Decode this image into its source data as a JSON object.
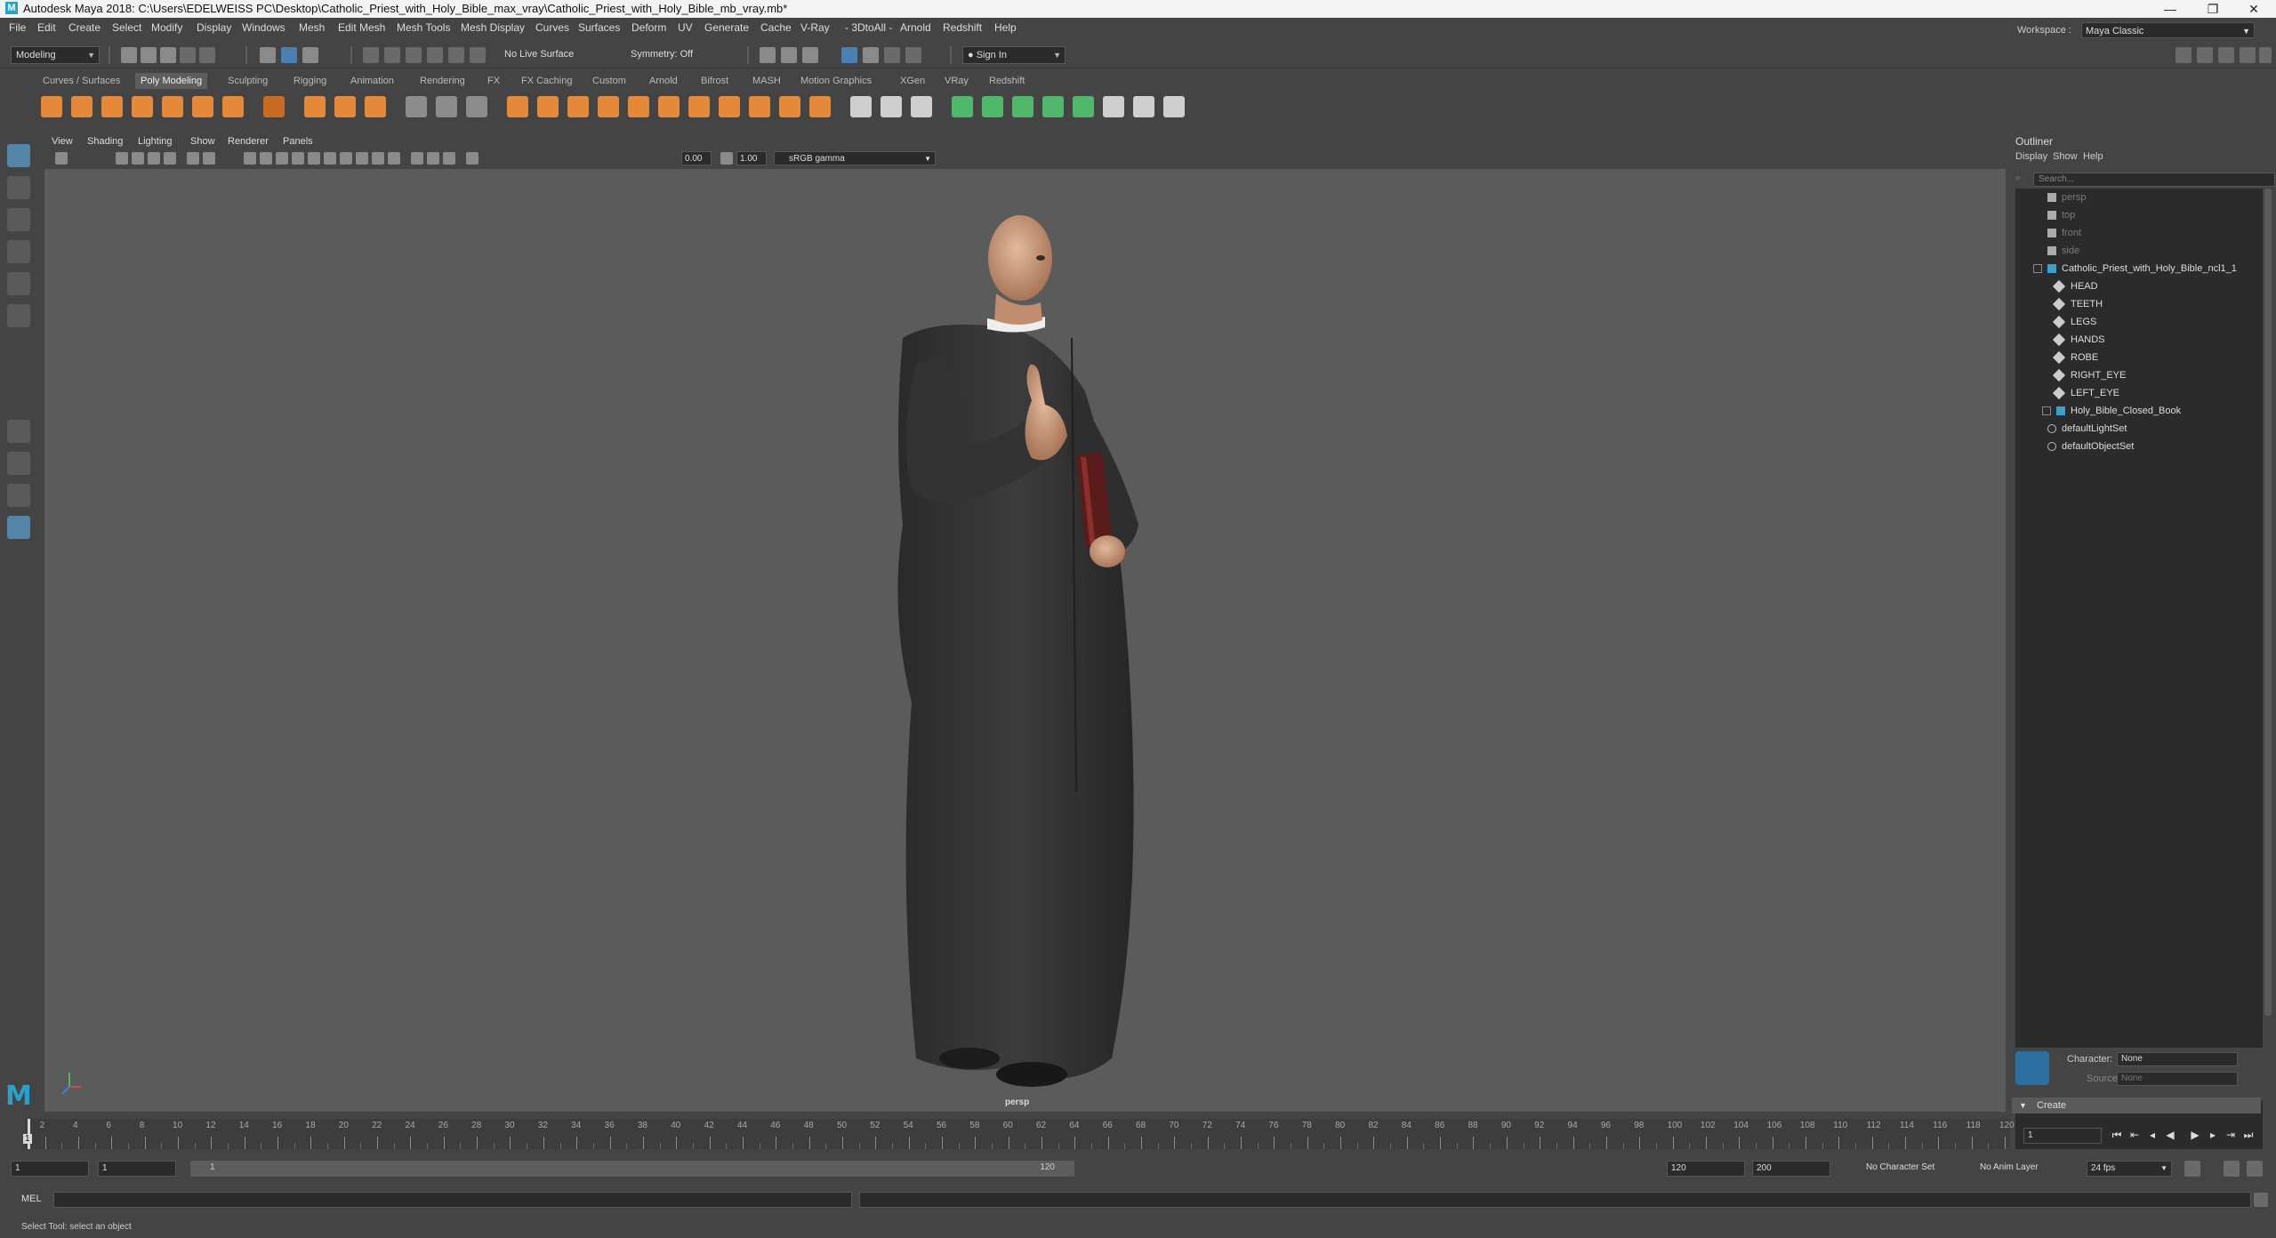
{
  "titlebar": {
    "title": "Autodesk Maya 2018: C:\\Users\\EDELWEISS PC\\Desktop\\Catholic_Priest_with_Holy_Bible_max_vray\\Catholic_Priest_with_Holy_Bible_mb_vray.mb*",
    "logo": "M",
    "minimize": "—",
    "maximize": "❐",
    "close": "✕"
  },
  "menubar": {
    "items": [
      "File",
      "Edit",
      "Create",
      "Select",
      "Modify",
      "Display",
      "Windows",
      "Mesh",
      "Edit Mesh",
      "Mesh Tools",
      "Mesh Display",
      "Curves",
      "Surfaces",
      "Deform",
      "UV",
      "Generate",
      "Cache",
      "V-Ray",
      "- 3DtoAll -",
      "Arnold",
      "Redshift",
      "Help"
    ],
    "workspace_label": "Workspace :",
    "workspace_value": "Maya Classic"
  },
  "statusline": {
    "mode": "Modeling",
    "live_surface": "No Live Surface",
    "symmetry": "Symmetry: Off",
    "sign_in": "Sign In"
  },
  "shelf": {
    "tabs": [
      "Curves / Surfaces",
      "Poly Modeling",
      "Sculpting",
      "Rigging",
      "Animation",
      "Rendering",
      "FX",
      "FX Caching",
      "Custom",
      "Arnold",
      "Bifrost",
      "MASH",
      "Motion Graphics",
      "XGen",
      "VRay",
      "Redshift"
    ],
    "active_tab": "Poly Modeling"
  },
  "viewport": {
    "menus": [
      "View",
      "Shading",
      "Lighting",
      "Show",
      "Renderer",
      "Panels"
    ],
    "exposure": "0.00",
    "gamma": "1.00",
    "color_space": "sRGB gamma",
    "camera_label": "persp"
  },
  "outliner": {
    "title": "Outliner",
    "menus": [
      "Display",
      "Show",
      "Help"
    ],
    "search_placeholder": "Search...",
    "items": [
      {
        "label": "persp",
        "kind": "camera",
        "indent": 0
      },
      {
        "label": "top",
        "kind": "camera",
        "indent": 0
      },
      {
        "label": "front",
        "kind": "camera",
        "indent": 0
      },
      {
        "label": "side",
        "kind": "camera",
        "indent": 0
      },
      {
        "label": "Catholic_Priest_with_Holy_Bible_ncl1_1",
        "kind": "group",
        "indent": 0
      },
      {
        "label": "HEAD",
        "kind": "mesh",
        "indent": 1
      },
      {
        "label": "TEETH",
        "kind": "mesh",
        "indent": 1
      },
      {
        "label": "LEGS",
        "kind": "mesh",
        "indent": 1
      },
      {
        "label": "HANDS",
        "kind": "mesh",
        "indent": 1
      },
      {
        "label": "ROBE",
        "kind": "mesh",
        "indent": 1
      },
      {
        "label": "RIGHT_EYE",
        "kind": "mesh",
        "indent": 1
      },
      {
        "label": "LEFT_EYE",
        "kind": "mesh",
        "indent": 1
      },
      {
        "label": "Holy_Bible_Closed_Book",
        "kind": "group",
        "indent": 1
      },
      {
        "label": "defaultLightSet",
        "kind": "set",
        "indent": 0
      },
      {
        "label": "defaultObjectSet",
        "kind": "set",
        "indent": 0
      }
    ]
  },
  "character": {
    "character_label": "Character:",
    "character_value": "None",
    "source_label": "Source:",
    "source_value": "None",
    "create_label": "Create"
  },
  "timeline": {
    "ticks": [
      2,
      4,
      6,
      8,
      10,
      12,
      14,
      16,
      18,
      20,
      22,
      24,
      26,
      28,
      30,
      32,
      34,
      36,
      38,
      40,
      42,
      44,
      46,
      48,
      50,
      52,
      54,
      56,
      58,
      60,
      62,
      64,
      66,
      68,
      70,
      72,
      74,
      76,
      78,
      80,
      82,
      84,
      86,
      88,
      90,
      92,
      94,
      96,
      98,
      100,
      102,
      104,
      106,
      108,
      110,
      112,
      114,
      116,
      118,
      120
    ],
    "start_tick": "1",
    "current_frame": "1",
    "current_frame_field": "1"
  },
  "range": {
    "start": "1",
    "playback_start": "1",
    "slider_start": "1",
    "slider_end": "120",
    "playback_end": "120",
    "end": "200",
    "character_set": "No Character Set",
    "anim_layer": "No Anim Layer",
    "fps": "24 fps"
  },
  "cmdline": {
    "label": "MEL"
  },
  "helpline": {
    "text": "Select Tool: select an object"
  },
  "colors": {
    "accent": "#5285a6",
    "shelf_orange": "#e4883a",
    "shelf_green": "#4fb86a",
    "viewport_bg": "#5b5b5b"
  }
}
